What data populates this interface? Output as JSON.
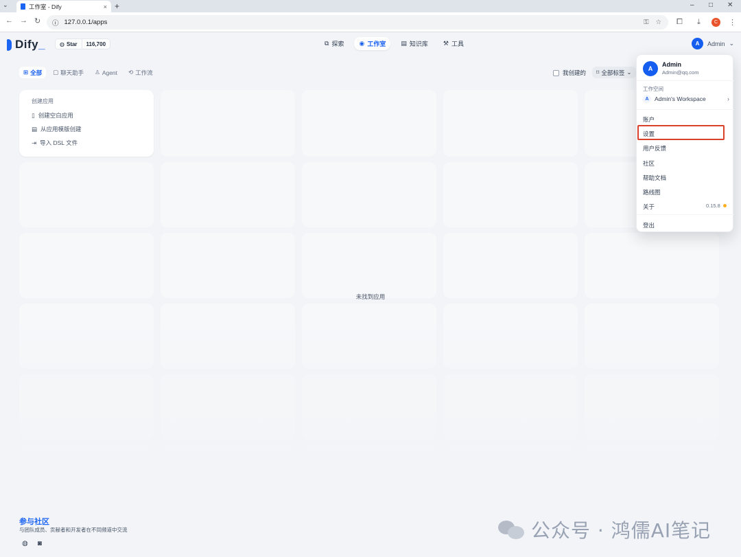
{
  "browser": {
    "tab_title": "工作室 - Dify",
    "tab_close": "×",
    "tab_list_icon": "⌄",
    "new_tab": "+",
    "url": "127.0.0.1/apps",
    "window_controls": {
      "minimize": "–",
      "maximize": "□",
      "close": "✕"
    },
    "nav": {
      "back": "←",
      "forward": "→",
      "reload": "↻"
    },
    "profile_initial": "C"
  },
  "header": {
    "logo_text": "Dify",
    "github_star": "Star",
    "github_count": "116,700",
    "nav": [
      {
        "label": "探索",
        "icon": "compass-icon",
        "glyph": "⧉",
        "active": false
      },
      {
        "label": "工作室",
        "icon": "robot-icon",
        "glyph": "◉",
        "active": true
      },
      {
        "label": "知识库",
        "icon": "book-icon",
        "glyph": "▤",
        "active": false
      },
      {
        "label": "工具",
        "icon": "hammer-icon",
        "glyph": "⚒",
        "active": false
      }
    ],
    "user_initial": "A",
    "user_name": "Admin"
  },
  "filters": {
    "tabs": [
      {
        "label": "全部",
        "glyph": "⊞",
        "active": true
      },
      {
        "label": "聊天助手",
        "glyph": "▢",
        "active": false
      },
      {
        "label": "Agent",
        "glyph": "♙",
        "active": false
      },
      {
        "label": "工作流",
        "glyph": "⟲",
        "active": false
      }
    ],
    "mine_label": "我创建的",
    "tags_label": "全部标签"
  },
  "create_card": {
    "title": "创建应用",
    "items": [
      {
        "label": "创建空白应用",
        "glyph": "▯"
      },
      {
        "label": "从应用模版创建",
        "glyph": "▤"
      },
      {
        "label": "导入 DSL 文件",
        "glyph": "⇥"
      }
    ]
  },
  "empty_text": "未找到应用",
  "footer": {
    "title": "参与社区",
    "subtitle": "与团队成员、贡献者和开发者在不同频道中交流"
  },
  "watermark": "公众号 · 鸿儒AI笔记",
  "dropdown": {
    "avatar": "A",
    "name": "Admin",
    "email": "Admin@qq.com",
    "workspace_label": "工作空间",
    "workspace_initial": "A",
    "workspace_name": "Admin's Workspace",
    "items": [
      "账户",
      "设置",
      "用户反馈",
      "社区",
      "帮助文档",
      "路线图",
      "关于"
    ],
    "version": "0.15.8",
    "logout": "登出"
  },
  "colors": {
    "accent": "#155eef",
    "highlight_box": "#d9412b",
    "version_dot": "#fdb022"
  }
}
